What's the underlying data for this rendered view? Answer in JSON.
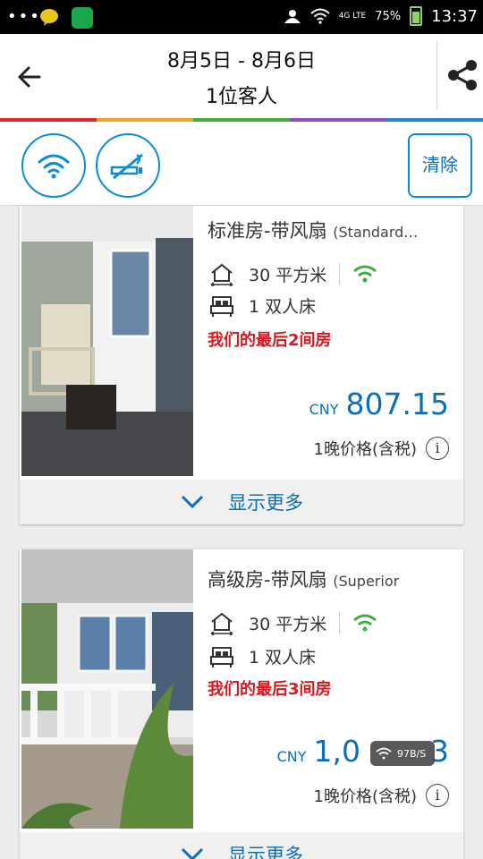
{
  "status_bar": {
    "network": "4G LTE",
    "battery": "75%",
    "time": "13:37"
  },
  "header": {
    "dates": "8月5日 - 8月6日",
    "guests": "1位客人"
  },
  "filters": {
    "clear_label": "清除",
    "icons": [
      "wifi-icon",
      "no-smoking-icon"
    ]
  },
  "colors": {
    "accent": "#0a8dd6",
    "alert": "#d8171f",
    "rainbow": [
      "#e0252b",
      "#f1a323",
      "#3fae3c",
      "#8d4fc3",
      "#1d87d6"
    ]
  },
  "rooms": [
    {
      "name": "标准房-带风扇",
      "name_en": "(Standard…",
      "area": "30 平方米",
      "bed": "1 双人床",
      "availability": "我们的最后2间房",
      "currency": "CNY",
      "price": "807.15",
      "price_note": "1晚价格(含税)",
      "more_label": "显示更多"
    },
    {
      "name": "高级房-带风扇",
      "name_en": "(Superior",
      "area": "30 平方米",
      "bed": "1 双人床",
      "availability": "我们的最后3间房",
      "currency": "CNY",
      "price": "1,0",
      "price_tail": "3",
      "price_note": "1晚价格(含税)",
      "more_label": "显示更多"
    }
  ],
  "overlay": {
    "speed": "97B/S"
  }
}
